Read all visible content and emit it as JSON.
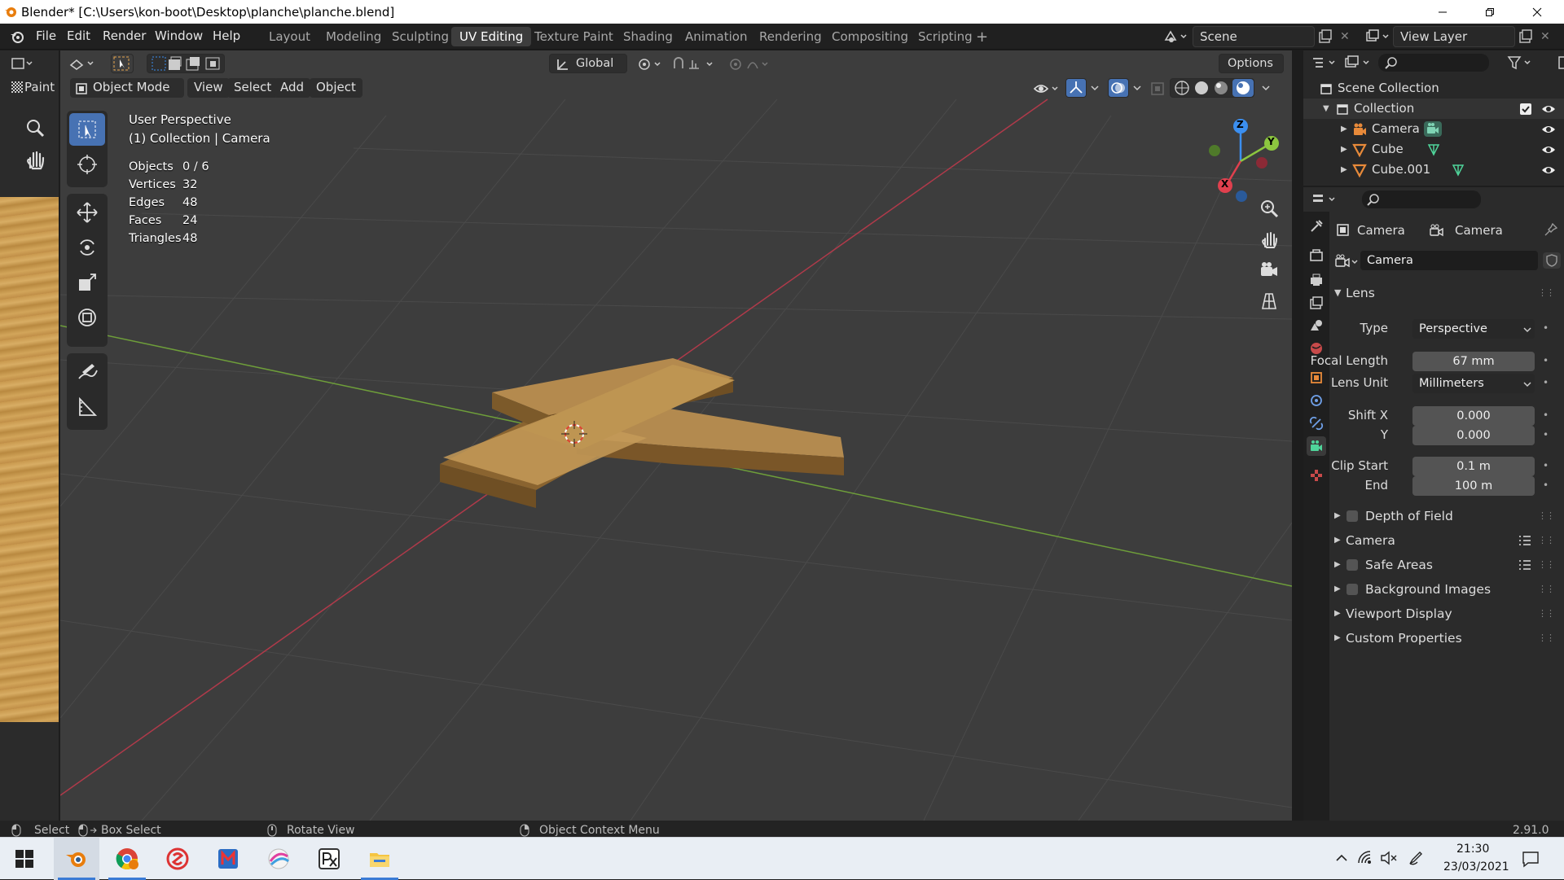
{
  "window": {
    "title": "Blender* [C:\\Users\\kon-boot\\Desktop\\planche\\planche.blend]"
  },
  "menu": [
    "File",
    "Edit",
    "Render",
    "Window",
    "Help"
  ],
  "workspaces": [
    "Layout",
    "Modeling",
    "Sculpting",
    "UV Editing",
    "Texture Paint",
    "Shading",
    "Animation",
    "Rendering",
    "Compositing",
    "Scripting"
  ],
  "active_workspace": "UV Editing",
  "scene": {
    "name": "Scene",
    "view_layer": "View Layer"
  },
  "left_editor": {
    "label": "Paint"
  },
  "viewport": {
    "mode": "Object Mode",
    "header_menus": [
      "View",
      "Select",
      "Add",
      "Object"
    ],
    "transform_orientation": "Global",
    "options_label": "Options",
    "view_name": "User Perspective",
    "collection_info": "(1) Collection | Camera",
    "stats": [
      {
        "label": "Objects",
        "value": "0 / 6"
      },
      {
        "label": "Vertices",
        "value": "32"
      },
      {
        "label": "Edges",
        "value": "48"
      },
      {
        "label": "Faces",
        "value": "24"
      },
      {
        "label": "Triangles",
        "value": "48"
      }
    ],
    "gizmo": {
      "x": "X",
      "y": "Y",
      "z": "Z"
    }
  },
  "outliner": {
    "root": "Scene Collection",
    "collection": "Collection",
    "items": [
      "Camera",
      "Cube",
      "Cube.001"
    ]
  },
  "properties": {
    "breadcrumb_object": "Camera",
    "breadcrumb_data": "Camera",
    "datablock": "Camera",
    "lens": {
      "title": "Lens",
      "type_label": "Type",
      "type_value": "Perspective",
      "focal_label": "Focal Length",
      "focal_value": "67 mm",
      "unit_label": "Lens Unit",
      "unit_value": "Millimeters",
      "shiftx_label": "Shift X",
      "shiftx_value": "0.000",
      "shifty_label": "Y",
      "shifty_value": "0.000",
      "clipstart_label": "Clip Start",
      "clipstart_value": "0.1 m",
      "clipend_label": "End",
      "clipend_value": "100 m"
    },
    "panels": [
      "Depth of Field",
      "Camera",
      "Safe Areas",
      "Background Images",
      "Viewport Display",
      "Custom Properties"
    ]
  },
  "status": {
    "select": "Select",
    "box_select": "Box Select",
    "rotate": "Rotate View",
    "context": "Object Context Menu",
    "version": "2.91.0"
  },
  "taskbar": {
    "time": "21:30",
    "date": "23/03/2021"
  },
  "colors": {
    "accent": "#4772b3",
    "x_axis": "#e0404e",
    "y_axis": "#8cc63f",
    "z_axis": "#3b8ff0",
    "wood": "#b48a4e"
  }
}
